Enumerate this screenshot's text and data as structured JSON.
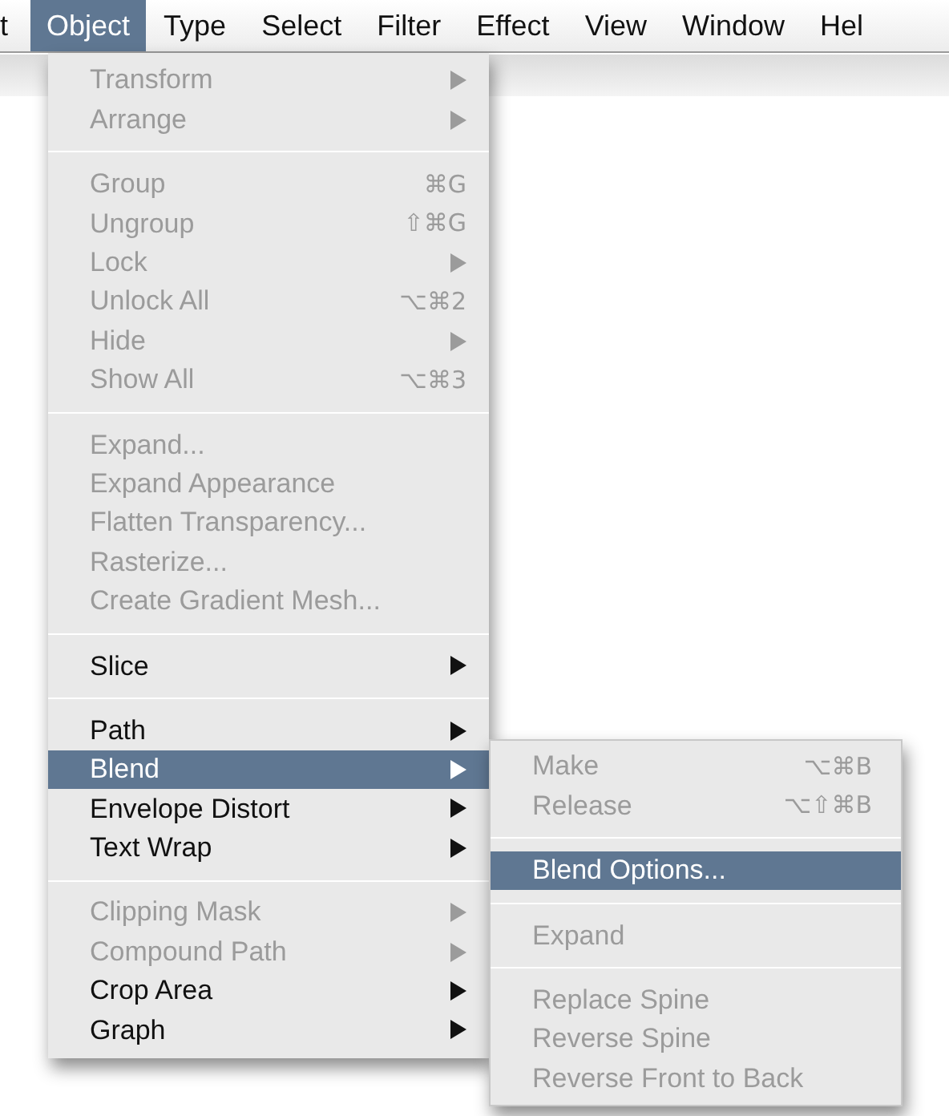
{
  "menubar": [
    {
      "label": "t",
      "selected": false
    },
    {
      "label": "Object",
      "selected": true
    },
    {
      "label": "Type",
      "selected": false
    },
    {
      "label": "Select",
      "selected": false
    },
    {
      "label": "Filter",
      "selected": false
    },
    {
      "label": "Effect",
      "selected": false
    },
    {
      "label": "View",
      "selected": false
    },
    {
      "label": "Window",
      "selected": false
    },
    {
      "label": "Hel",
      "selected": false
    }
  ],
  "object_menu": {
    "groups": [
      [
        {
          "label": "Transform",
          "submenu": true,
          "disabled": true,
          "selected": false
        },
        {
          "label": "Arrange",
          "submenu": true,
          "disabled": true,
          "selected": false
        }
      ],
      [
        {
          "label": "Group",
          "shortcut": "⌘G",
          "submenu": false,
          "disabled": true,
          "selected": false
        },
        {
          "label": "Ungroup",
          "shortcut": "⇧⌘G",
          "submenu": false,
          "disabled": true,
          "selected": false
        },
        {
          "label": "Lock",
          "submenu": true,
          "disabled": true,
          "selected": false
        },
        {
          "label": "Unlock All",
          "shortcut": "⌥⌘2",
          "submenu": false,
          "disabled": true,
          "selected": false
        },
        {
          "label": "Hide",
          "submenu": true,
          "disabled": true,
          "selected": false
        },
        {
          "label": "Show All",
          "shortcut": "⌥⌘3",
          "submenu": false,
          "disabled": true,
          "selected": false
        }
      ],
      [
        {
          "label": "Expand...",
          "submenu": false,
          "disabled": true,
          "selected": false
        },
        {
          "label": "Expand Appearance",
          "submenu": false,
          "disabled": true,
          "selected": false
        },
        {
          "label": "Flatten Transparency...",
          "submenu": false,
          "disabled": true,
          "selected": false
        },
        {
          "label": "Rasterize...",
          "submenu": false,
          "disabled": true,
          "selected": false
        },
        {
          "label": "Create Gradient Mesh...",
          "submenu": false,
          "disabled": true,
          "selected": false
        }
      ],
      [
        {
          "label": "Slice",
          "submenu": true,
          "disabled": false,
          "selected": false
        }
      ],
      [
        {
          "label": "Path",
          "submenu": true,
          "disabled": false,
          "selected": false
        },
        {
          "label": "Blend",
          "submenu": true,
          "disabled": false,
          "selected": true
        },
        {
          "label": "Envelope Distort",
          "submenu": true,
          "disabled": false,
          "selected": false
        },
        {
          "label": "Text Wrap",
          "submenu": true,
          "disabled": false,
          "selected": false
        }
      ],
      [
        {
          "label": "Clipping Mask",
          "submenu": true,
          "disabled": true,
          "selected": false
        },
        {
          "label": "Compound Path",
          "submenu": true,
          "disabled": true,
          "selected": false
        },
        {
          "label": "Crop Area",
          "submenu": true,
          "disabled": false,
          "selected": false
        },
        {
          "label": "Graph",
          "submenu": true,
          "disabled": false,
          "selected": false
        }
      ]
    ]
  },
  "blend_submenu": {
    "groups": [
      [
        {
          "label": "Make",
          "shortcut": "⌥⌘B",
          "submenu": false,
          "disabled": true,
          "selected": false
        },
        {
          "label": "Release",
          "shortcut": "⌥⇧⌘B",
          "submenu": false,
          "disabled": true,
          "selected": false
        }
      ],
      [
        {
          "label": "Blend Options...",
          "submenu": false,
          "disabled": false,
          "selected": true
        }
      ],
      [
        {
          "label": "Expand",
          "submenu": false,
          "disabled": true,
          "selected": false
        }
      ],
      [
        {
          "label": "Replace Spine",
          "submenu": false,
          "disabled": true,
          "selected": false
        },
        {
          "label": "Reverse Spine",
          "submenu": false,
          "disabled": true,
          "selected": false
        },
        {
          "label": "Reverse Front to Back",
          "submenu": false,
          "disabled": true,
          "selected": false
        }
      ]
    ]
  }
}
